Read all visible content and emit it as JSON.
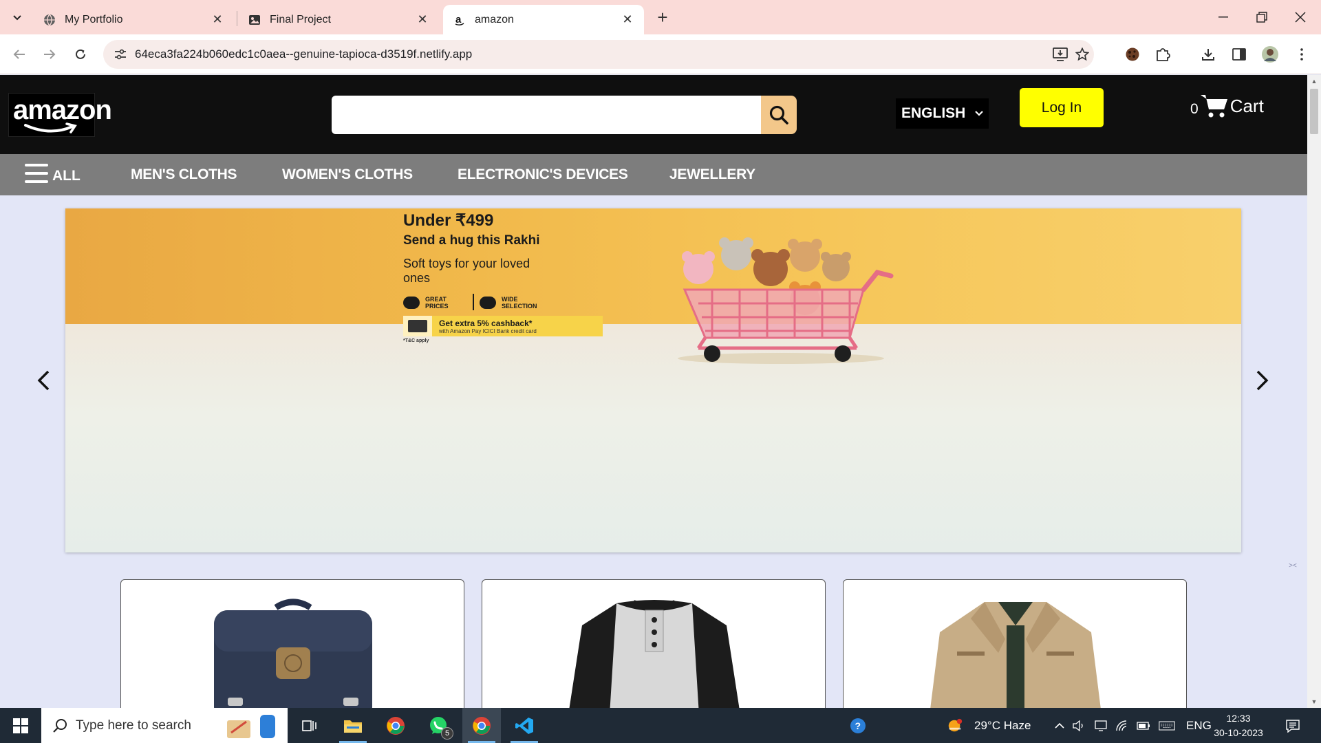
{
  "browser": {
    "tabs": [
      {
        "title": "My Portfolio",
        "active": false
      },
      {
        "title": "Final Project",
        "active": false
      },
      {
        "title": "amazon",
        "active": true
      }
    ],
    "url": "64eca3fa224b060edc1c0aea--genuine-tapioca-d3519f.netlify.app"
  },
  "site": {
    "logo_text": "amazon",
    "search_value": "",
    "language": "ENGLISH",
    "login_label": "Log In",
    "cart_count": "0",
    "cart_label": "Cart",
    "all_label": "ALL",
    "categories": [
      "MEN'S CLOTHS",
      "WOMEN'S CLOTHS",
      "ELECTRONIC'S DEVICES",
      "JEWELLERY"
    ]
  },
  "banner": {
    "headline": "Under ₹499",
    "sub1": "Send a hug this Rakhi",
    "sub2": "Soft toys for your loved ones",
    "badge1": "GREAT PRICES",
    "badge2": "WIDE SELECTION",
    "cashback_main": "Get extra 5% cashback*",
    "cashback_small": "with Amazon Pay ICICI Bank credit card",
    "tc": "*T&C apply"
  },
  "products": [
    {
      "name": "backpack",
      "color": "#2f3a52"
    },
    {
      "name": "raglan-henley-shirt",
      "color": "#1c1c1c"
    },
    {
      "name": "jacket",
      "color": "#c7ad86"
    }
  ],
  "taskbar": {
    "search_placeholder": "Type here to search",
    "whatsapp_badge": "5",
    "weather": "29°C  Haze",
    "language": "ENG",
    "time": "12:33",
    "date": "30-10-2023"
  },
  "colors": {
    "tabstrip": "#fadbd8",
    "header": "#0f0f0f",
    "catnav": "#7d7d7d",
    "login": "#ffff00",
    "page_bg": "#e3e6f7"
  }
}
